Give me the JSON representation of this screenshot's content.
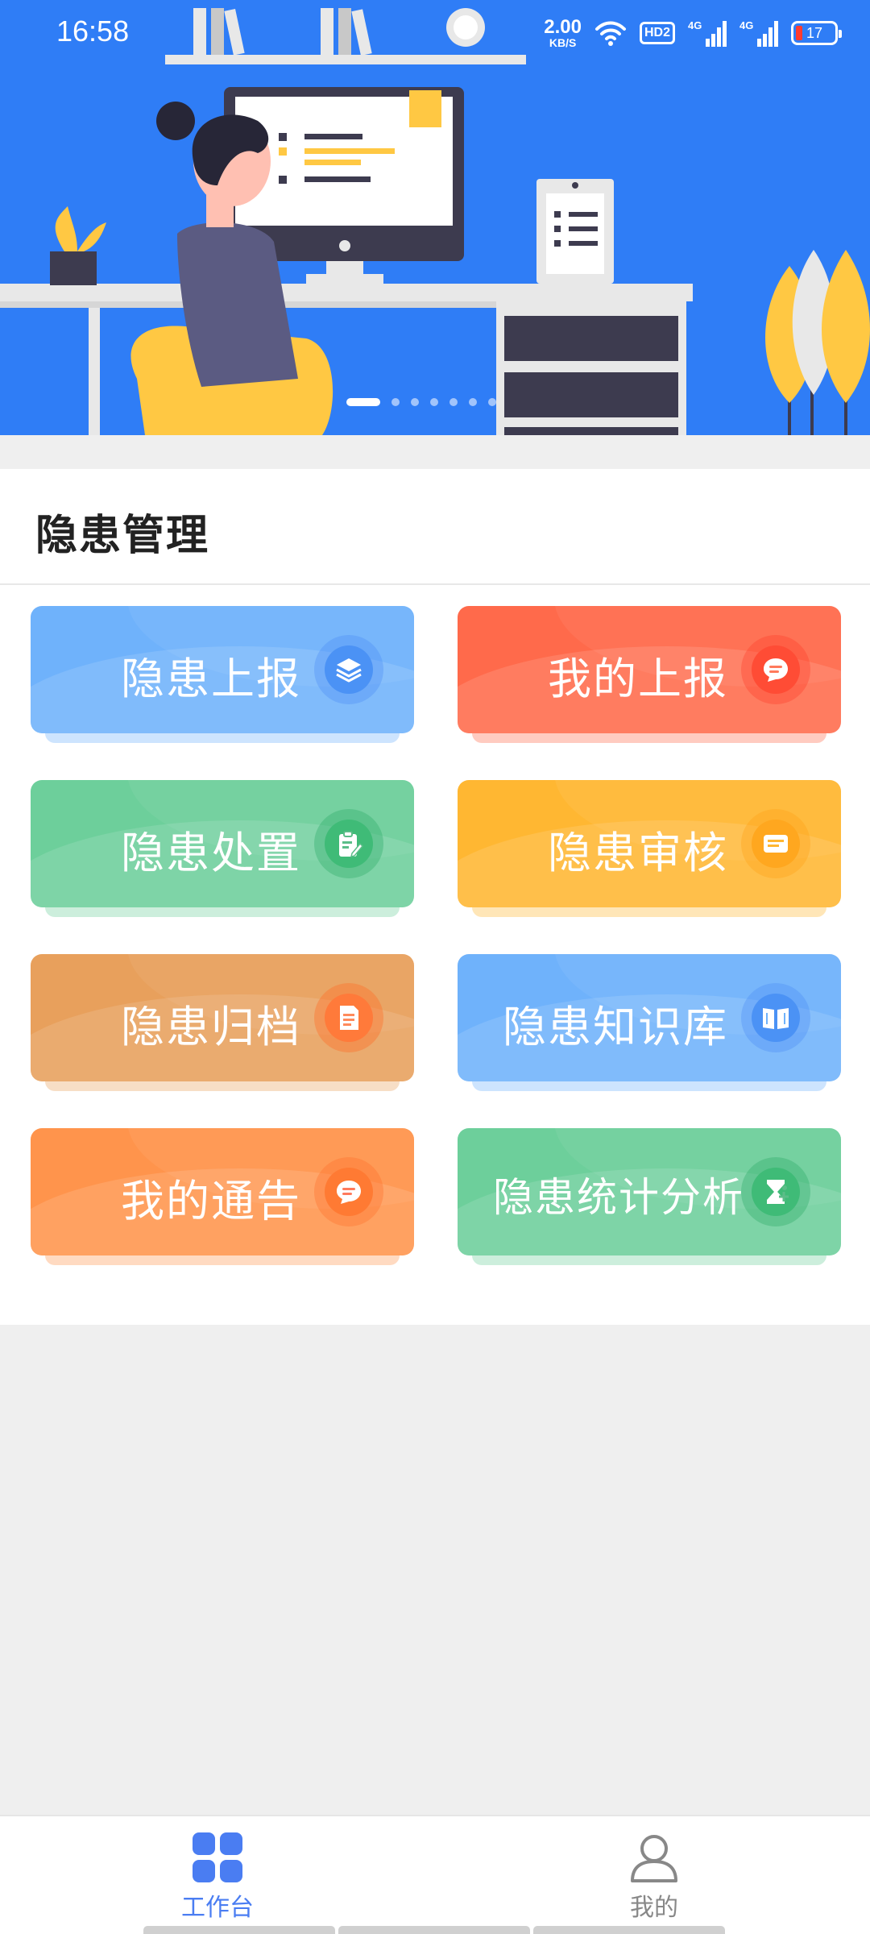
{
  "status_bar": {
    "time": "16:58",
    "net_speed_value": "2.00",
    "net_speed_unit": "KB/S",
    "hd_label": "HD2",
    "signal1_label": "4G",
    "signal2_label": "4G",
    "battery": "17"
  },
  "banner": {
    "total_slides": 7,
    "active_slide": 1
  },
  "section": {
    "title": "隐患管理",
    "cards": [
      {
        "label": "隐患上报",
        "icon": "layers-icon",
        "color": "#6fb2fb"
      },
      {
        "label": "我的上报",
        "icon": "message-icon",
        "color": "#ff6a4b"
      },
      {
        "label": "隐患处置",
        "icon": "clipboard-edit-icon",
        "color": "#6dcf9b"
      },
      {
        "label": "隐患审核",
        "icon": "card-icon",
        "color": "#ffb732"
      },
      {
        "label": "隐患归档",
        "icon": "document-icon",
        "color": "#e8a05c"
      },
      {
        "label": "隐患知识库",
        "icon": "book-icon",
        "color": "#6fb2fb"
      },
      {
        "label": "我的通告",
        "icon": "message-icon",
        "color": "#ff944c"
      },
      {
        "label": "隐患统计分析",
        "icon": "hourglass-icon",
        "color": "#6dcf9b"
      }
    ]
  },
  "bottom_nav": {
    "items": [
      {
        "label": "工作台",
        "active": true,
        "icon": "grid-icon",
        "color": "#4a7df2"
      },
      {
        "label": "我的",
        "active": false,
        "icon": "user-icon",
        "color": "#888888"
      }
    ]
  }
}
